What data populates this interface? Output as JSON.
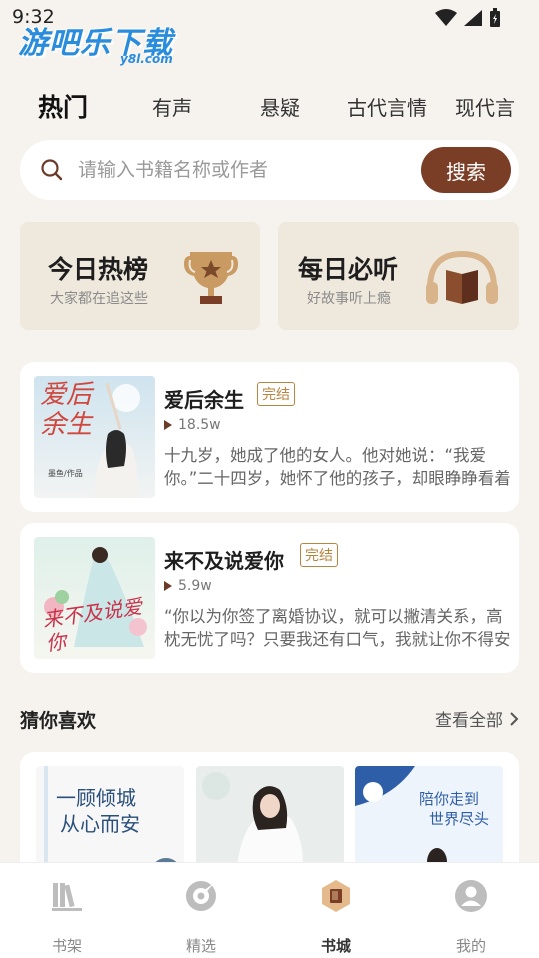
{
  "status": {
    "time": "9:32"
  },
  "watermark": {
    "main": "游吧乐下载",
    "sub": "y8l.com"
  },
  "tabs": [
    {
      "label": "热门",
      "active": true
    },
    {
      "label": "有声"
    },
    {
      "label": "悬疑"
    },
    {
      "label": "古代言情"
    },
    {
      "label": "现代言"
    }
  ],
  "search": {
    "placeholder": "请输入书籍名称或作者",
    "button": "搜索"
  },
  "promos": [
    {
      "title": "今日热榜",
      "subtitle": "大家都在追这些",
      "icon": "trophy-icon"
    },
    {
      "title": "每日必听",
      "subtitle": "好故事听上瘾",
      "icon": "headphones-book-icon"
    }
  ],
  "books": [
    {
      "title": "爱后余生",
      "badge": "完结",
      "plays": "18.5w",
      "desc": "十九岁，她成了他的女人。他对她说：“我爱你。”二十四岁，她怀了他的孩子，却眼睁睁看着他娶了别人。",
      "cover_text": "爱后余生",
      "cover_author": "墨鱼/作品"
    },
    {
      "title": "来不及说爱你",
      "badge": "完结",
      "plays": "5.9w",
      "desc": "“你以为你签了离婚协议，就可以撇清关系，高枕无忧了吗？只要我还有口气，我就让你不得安宁。”",
      "cover_text": "来不及说爱你"
    }
  ],
  "guess": {
    "title": "猜你喜欢",
    "more": "查看全部",
    "items": [
      {
        "cover_text_1": "一顾倾城",
        "cover_text_2": "从心而安"
      },
      {
        "cover_text_1": ""
      },
      {
        "cover_text_1": "陪你走到",
        "cover_text_2": "世界尽头"
      }
    ]
  },
  "nav": [
    {
      "label": "书架",
      "icon": "bookshelf-icon"
    },
    {
      "label": "精选",
      "icon": "compass-icon"
    },
    {
      "label": "书城",
      "icon": "bookstore-icon",
      "active": true
    },
    {
      "label": "我的",
      "icon": "profile-icon"
    }
  ],
  "colors": {
    "accent": "#7a3d26",
    "badge": "#b8843f",
    "background": "#f6f3ee",
    "promo_bg": "#efe8dd"
  }
}
